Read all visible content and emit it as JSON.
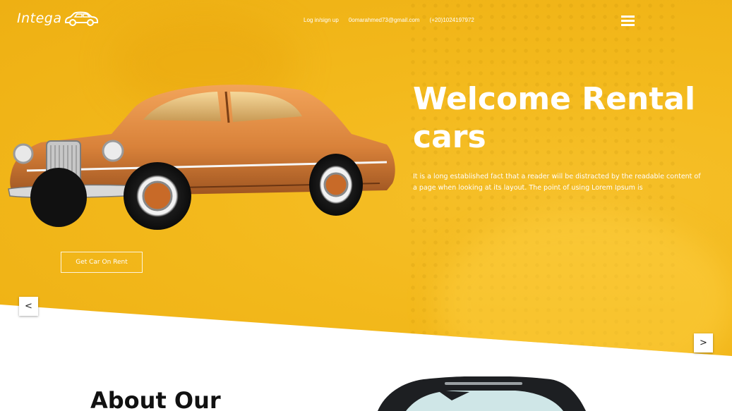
{
  "brand": {
    "name": "Intega"
  },
  "nav": {
    "login": "Log in/sign up",
    "email": "0omarahmed73@gmail.com",
    "phone": "(+20)1024197972"
  },
  "hero": {
    "title": "Welcome Rental cars",
    "description": "It is a long established fact that a reader will be distracted by the readable content of a page when looking at its layout. The point of using Lorem Ipsum is",
    "cta": "Get Car On Rent"
  },
  "slider": {
    "prev": "<",
    "next": ">"
  },
  "about": {
    "title": "About Our"
  },
  "colors": {
    "accent": "#f3b91c",
    "text_light": "#ffffff",
    "text_dark": "#111111"
  },
  "icons": {
    "menu": "hamburger-icon",
    "logo_car": "car-logo-icon"
  }
}
